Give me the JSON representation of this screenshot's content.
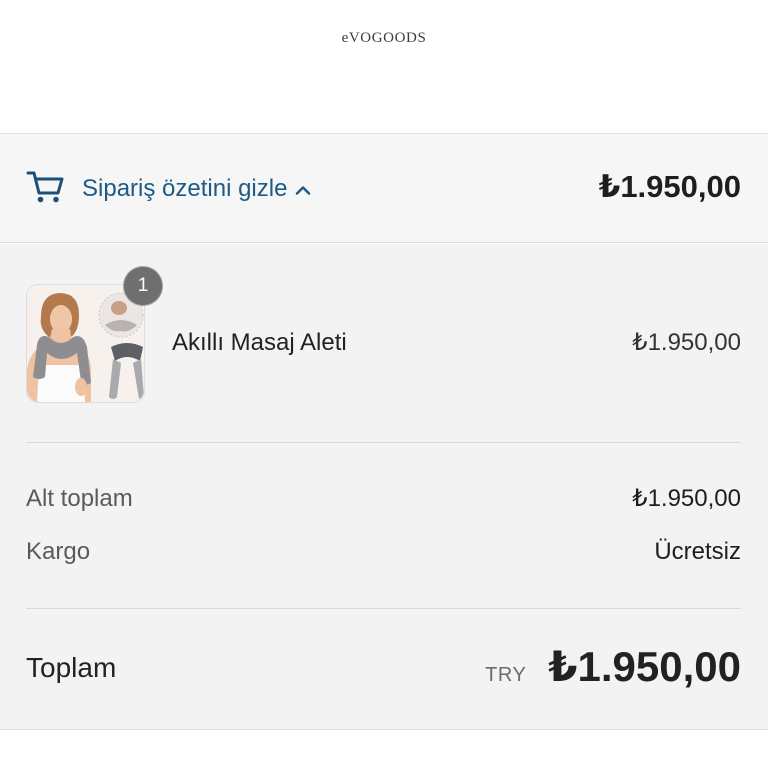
{
  "header": {
    "logo_text": "eVOGOODS"
  },
  "summary_toggle": {
    "icon": "cart-icon",
    "label": "Sipariş özetini gizle",
    "chevron": "chevron-up-icon",
    "total": "₺1.950,00"
  },
  "line_items": [
    {
      "quantity": "1",
      "name": "Akıllı Masaj Aleti",
      "price": "₺1.950,00"
    }
  ],
  "totals": {
    "subtotal_label": "Alt toplam",
    "subtotal_value": "₺1.950,00",
    "shipping_label": "Kargo",
    "shipping_value": "Ücretsiz",
    "total_label": "Toplam",
    "currency": "TRY",
    "total_value": "₺1.950,00"
  },
  "colors": {
    "accent": "#1d5b86",
    "summary_background": "#f3f3f3",
    "badge": "#6f6f6f",
    "text": "#222222"
  }
}
